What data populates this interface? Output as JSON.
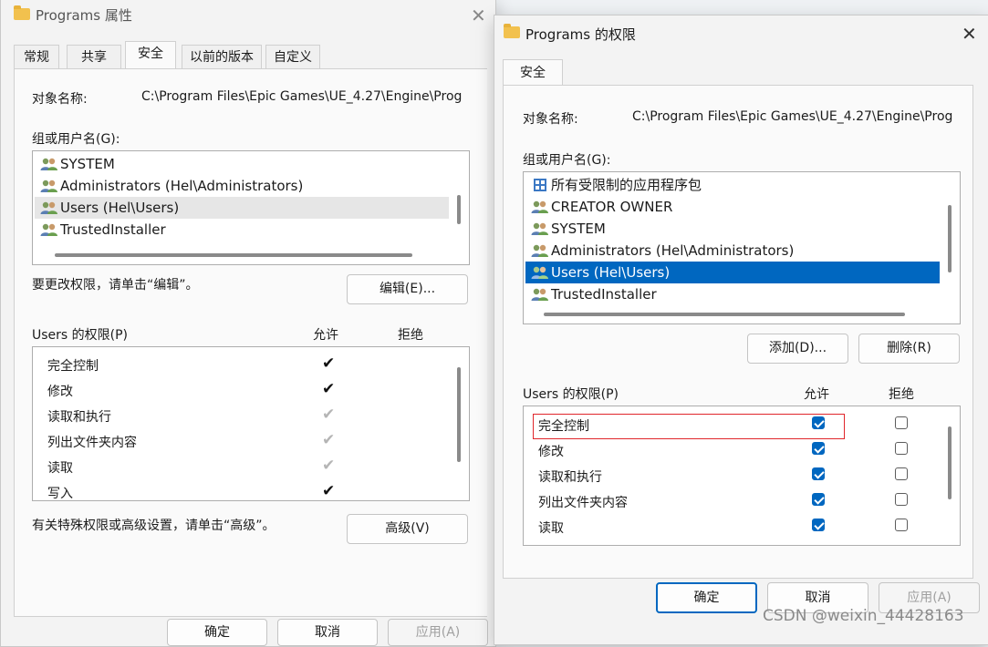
{
  "colors": {
    "accent": "#0067c0",
    "highlight_box": "#e0262b"
  },
  "icons": {
    "folder": "folder-icon",
    "users": "users-group-icon",
    "app_package": "app-package-icon",
    "close": "close-icon",
    "check": "checkmark-icon"
  },
  "left": {
    "title": "Programs 属性",
    "tabs": [
      "常规",
      "共享",
      "安全",
      "以前的版本",
      "自定义"
    ],
    "active_tab": "安全",
    "object_label": "对象名称:",
    "object_value": "C:\\Program Files\\Epic Games\\UE_4.27\\Engine\\Prog",
    "group_label": "组或用户名(G):",
    "users": [
      "SYSTEM",
      "Administrators (Hel\\Administrators)",
      "Users (Hel\\Users)",
      "TrustedInstaller"
    ],
    "selected_user": "Users (Hel\\Users)",
    "change_hint": "要更改权限，请单击“编辑”。",
    "edit_button": "编辑(E)...",
    "perm_header": "Users 的权限(P)",
    "allow_header": "允许",
    "deny_header": "拒绝",
    "permissions": [
      {
        "name": "完全控制",
        "allow": "explicit",
        "deny": "none"
      },
      {
        "name": "修改",
        "allow": "explicit",
        "deny": "none"
      },
      {
        "name": "读取和执行",
        "allow": "inherited",
        "deny": "none"
      },
      {
        "name": "列出文件夹内容",
        "allow": "inherited",
        "deny": "none"
      },
      {
        "name": "读取",
        "allow": "inherited",
        "deny": "none"
      },
      {
        "name": "写入",
        "allow": "explicit",
        "deny": "none"
      }
    ],
    "advanced_hint": "有关特殊权限或高级设置，请单击“高级”。",
    "advanced_button": "高级(V)",
    "ok_button": "确定",
    "cancel_button": "取消",
    "apply_button": "应用(A)"
  },
  "right": {
    "title": "Programs 的权限",
    "tab": "安全",
    "object_label": "对象名称:",
    "object_value": "C:\\Program Files\\Epic Games\\UE_4.27\\Engine\\Prog",
    "group_label": "组或用户名(G):",
    "users": [
      "所有受限制的应用程序包",
      "CREATOR OWNER",
      "SYSTEM",
      "Administrators (Hel\\Administrators)",
      "Users (Hel\\Users)",
      "TrustedInstaller"
    ],
    "selected_user": "Users (Hel\\Users)",
    "add_button": "添加(D)...",
    "remove_button": "删除(R)",
    "perm_header": "Users 的权限(P)",
    "allow_header": "允许",
    "deny_header": "拒绝",
    "permissions": [
      {
        "name": "完全控制",
        "allow": true,
        "deny": false
      },
      {
        "name": "修改",
        "allow": true,
        "deny": false
      },
      {
        "name": "读取和执行",
        "allow": true,
        "deny": false
      },
      {
        "name": "列出文件夹内容",
        "allow": true,
        "deny": false
      },
      {
        "name": "读取",
        "allow": true,
        "deny": false
      }
    ],
    "ok_button": "确定",
    "cancel_button": "取消",
    "apply_button": "应用(A)"
  },
  "watermark": "CSDN @weixin_44428163"
}
